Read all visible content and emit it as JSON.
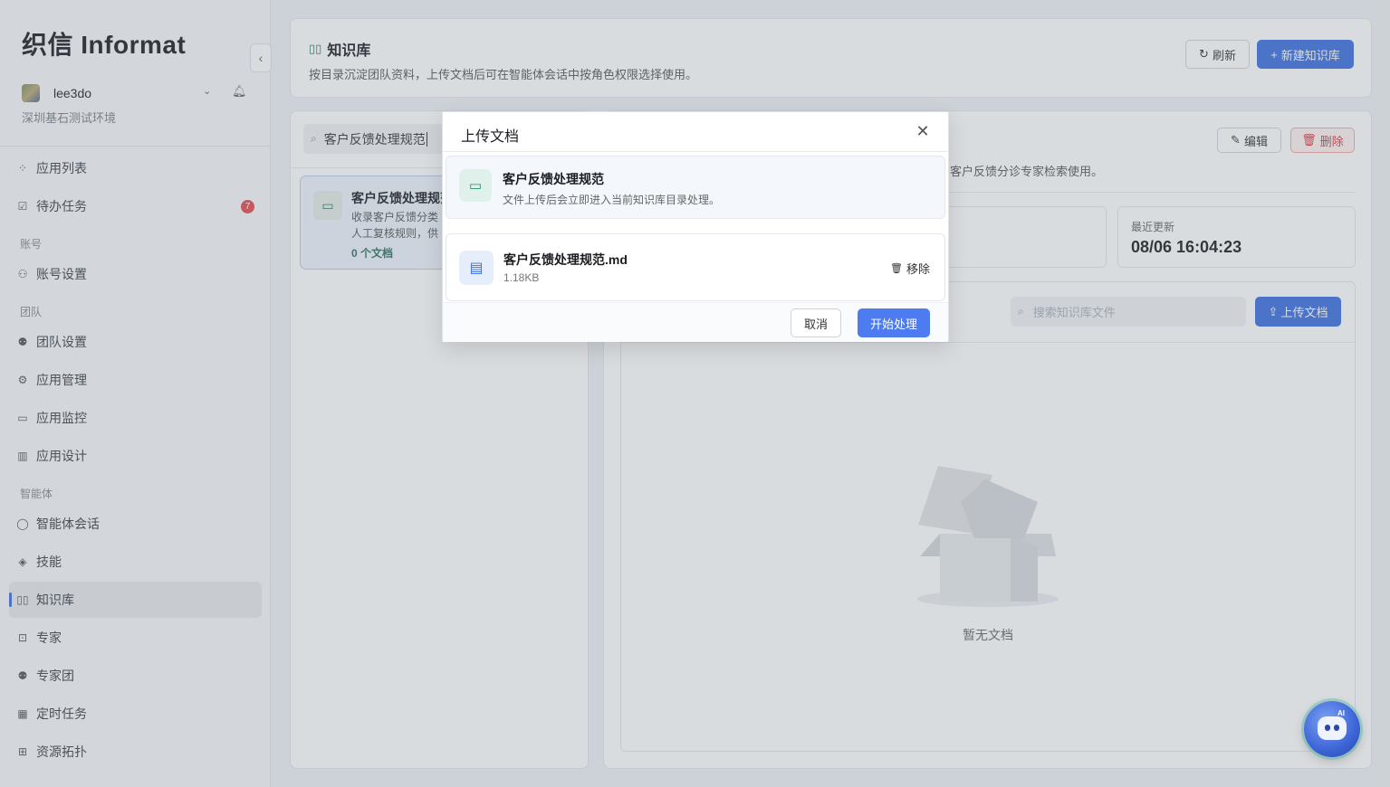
{
  "app": {
    "brand": "织信 Informat"
  },
  "user": {
    "name": "lee3do",
    "environment": "深圳基石测试环境"
  },
  "sidebar": {
    "items": [
      {
        "label": "应用列表",
        "icon": "grid-icon"
      },
      {
        "label": "待办任务",
        "icon": "checkbox-icon",
        "badge": "7"
      },
      {
        "section": "账号"
      },
      {
        "label": "账号设置",
        "icon": "user-gear-icon"
      },
      {
        "section": "团队"
      },
      {
        "label": "团队设置",
        "icon": "team-icon"
      },
      {
        "label": "应用管理",
        "icon": "gear-icon"
      },
      {
        "label": "应用监控",
        "icon": "monitor-icon"
      },
      {
        "label": "应用设计",
        "icon": "design-icon"
      },
      {
        "section": "智能体"
      },
      {
        "label": "智能体会话",
        "icon": "chat-icon"
      },
      {
        "label": "技能",
        "icon": "layers-icon"
      },
      {
        "label": "知识库",
        "icon": "book-icon",
        "active": true
      },
      {
        "label": "专家",
        "icon": "robot-icon"
      },
      {
        "label": "专家团",
        "icon": "group-icon"
      },
      {
        "label": "定时任务",
        "icon": "calendar-clock-icon"
      },
      {
        "label": "资源拓扑",
        "icon": "topology-icon"
      }
    ]
  },
  "header": {
    "title": "知识库",
    "description": "按目录沉淀团队资料，上传文档后可在智能体会话中按角色权限选择使用。",
    "refresh_label": "刷新",
    "new_label": "新建知识库"
  },
  "left_panel": {
    "search_value": "客户反馈处理规范",
    "kb_item": {
      "name": "客户反馈处理规范",
      "description": "收录客户反馈分类、人工复核规则，供客",
      "desc_line1": "收录客户反馈分类",
      "desc_line2": "人工复核规则，供",
      "count": "0 个文档"
    }
  },
  "right_panel": {
    "edit_label": "编辑",
    "delete_label": "删除",
    "description_tail": "客户反馈分诊专家检索使用。",
    "stats": {
      "updated_label": "最近更新",
      "updated_value": "08/06 16:04:23"
    },
    "file_search_placeholder": "搜索知识库文件",
    "upload_label": "上传文档",
    "empty_text": "暂无文档"
  },
  "modal": {
    "title": "上传文档",
    "target": {
      "name": "客户反馈处理规范",
      "hint": "文件上传后会立即进入当前知识库目录处理。"
    },
    "file": {
      "name": "客户反馈处理规范.md",
      "size": "1.18KB",
      "remove_label": "移除"
    },
    "cancel_label": "取消",
    "start_label": "开始处理"
  },
  "ai_assistant": {
    "tag": "AI"
  },
  "colors": {
    "primary": "#3b6fe0",
    "accent_green": "#2f6f5e",
    "danger": "#d6393f",
    "badge": "#e5484d"
  }
}
